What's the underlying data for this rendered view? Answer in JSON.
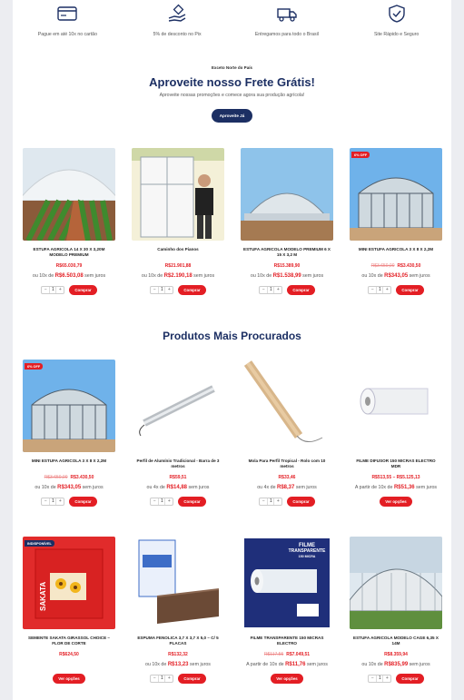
{
  "features": [
    {
      "icon": "credit-card-icon",
      "text": "Pague em até 10x no cartão"
    },
    {
      "icon": "pix-hand-icon",
      "text": "5% de desconto no Pix"
    },
    {
      "icon": "delivery-truck-icon",
      "text": "Entregamos para todo o Brasil"
    },
    {
      "icon": "shield-check-icon",
      "text": "Site Rápido e Seguro"
    }
  ],
  "promo": {
    "kicker": "Exceto Norte do País",
    "headline": "Aproveite nosso Frete Grátis!",
    "sub": "Aproveite nossas promoções e comece agora sua produção agrícola!",
    "cta": "Aproveite Já"
  },
  "featured_products": [
    {
      "name": "ESTUFA AGRICOLA 14 X 30 X 3,20M MODELO PREMIUM",
      "old": "",
      "price": "R$65.030,79",
      "inst_prefix": "ou 10x de",
      "inst_value": "R$6.503,08",
      "inst_suffix": "sem juros",
      "qty": "1",
      "button": "Comprar",
      "badge": "",
      "image": "greenhouse-tunnel-plants"
    },
    {
      "name": "Caminho dos Pianos",
      "old": "",
      "price": "R$21.901,88",
      "inst_prefix": "ou 10x de",
      "inst_value": "R$2.190,18",
      "inst_suffix": "sem juros",
      "qty": "1",
      "button": "Comprar",
      "badge": "",
      "image": "greenhouse-frame-man"
    },
    {
      "name": "ESTUFA AGRICOLA MODELO PREMIUM 6 X 15 X 3,2 M",
      "old": "",
      "price": "R$15.389,90",
      "inst_prefix": "ou 10x de",
      "inst_value": "R$1.538,99",
      "inst_suffix": "sem juros",
      "qty": "1",
      "button": "Comprar",
      "badge": "",
      "image": "greenhouse-dome"
    },
    {
      "name": "MINI ESTUFA AGRICOLA 3 X 8 X 2,2M",
      "old": "R$3.650,00",
      "price": "R$3.430,50",
      "inst_prefix": "ou 10x de",
      "inst_value": "R$343,05",
      "inst_suffix": "sem juros",
      "qty": "1",
      "button": "Comprar",
      "badge": "6% OFF",
      "image": "mini-greenhouse"
    }
  ],
  "popular_title": "Produtos Mais Procurados",
  "popular_products": [
    {
      "name": "MINI ESTUFA AGRICOLA 3 X 8 X 2,2M",
      "old": "R$3.650,00",
      "price": "R$3.430,50",
      "inst_prefix": "ou 10x de",
      "inst_value": "R$343,05",
      "inst_suffix": "sem juros",
      "qty": "1",
      "button": "Comprar",
      "badge": "6% OFF",
      "image": "mini-greenhouse"
    },
    {
      "name": "Perfil de Alumínio Tradicional - Barra de 3 metros",
      "old": "",
      "price": "R$59,51",
      "inst_prefix": "ou 4x de",
      "inst_value": "R$14,88",
      "inst_suffix": "sem juros",
      "qty": "1",
      "button": "Comprar",
      "badge": "",
      "image": "aluminum-profile"
    },
    {
      "name": "Mola Para Perfil Tropical - Rolo com 10 metros",
      "old": "",
      "price": "R$33,46",
      "inst_prefix": "ou 4x de",
      "inst_value": "R$8,37",
      "inst_suffix": "sem juros",
      "qty": "1",
      "button": "Comprar",
      "badge": "",
      "image": "spring-wire-roll"
    },
    {
      "name": "FILME DIFUSOR 150 MICRAS ELECTRO MDR",
      "old": "",
      "price": "R$513,55 – R$5.125,13",
      "inst_prefix": "A partir de 10x de",
      "inst_value": "R$51,36",
      "inst_suffix": "sem juros",
      "qty": "",
      "button": "Ver opções",
      "badge": "",
      "image": "film-roll-white"
    },
    {
      "name": "SEMENTE SAKATA GIRASSOL CHOICE – FLOR DE CORTE",
      "old": "",
      "price": "R$624,50",
      "inst_prefix": "",
      "inst_value": "",
      "inst_suffix": "",
      "qty": "",
      "button": "Ver opções",
      "badge": "INDISPONÍVEL",
      "image": "sakata-seed-pack"
    },
    {
      "name": "ESPUMA FENOLICA 3,7 X 3,7 X 5,0 – C/ 5 PLACAS",
      "old": "",
      "price": "R$132,32",
      "inst_prefix": "ou 10x de",
      "inst_value": "R$13,23",
      "inst_suffix": "sem juros",
      "qty": "1",
      "button": "Comprar",
      "badge": "",
      "image": "phenolic-foam-box"
    },
    {
      "name": "FILME TRANSPARENTE 150 MICRAS ELECTRO",
      "old": "R$117,55",
      "price": "R$7.049,51",
      "inst_prefix": "A partir de 10x de",
      "inst_value": "R$11,76",
      "inst_suffix": "sem juros",
      "qty": "",
      "button": "Ver opções",
      "badge": "",
      "image": "transparent-film-roll"
    },
    {
      "name": "ESTUFA AGRICOLA MODELO CAGE 6,35 X 14M",
      "old": "",
      "price": "R$8.359,94",
      "inst_prefix": "ou 10x de",
      "inst_value": "R$835,99",
      "inst_suffix": "sem juros",
      "qty": "1",
      "button": "Comprar",
      "badge": "",
      "image": "cage-greenhouse"
    }
  ],
  "film_label": {
    "line1": "FILME",
    "line2": "TRANSPARENTE",
    "line3": "150 MICRA"
  },
  "sakata_label": "SAKATA",
  "colors": {
    "navy": "#1c2f63",
    "red": "#e31e24",
    "background": "#ecedf1"
  }
}
